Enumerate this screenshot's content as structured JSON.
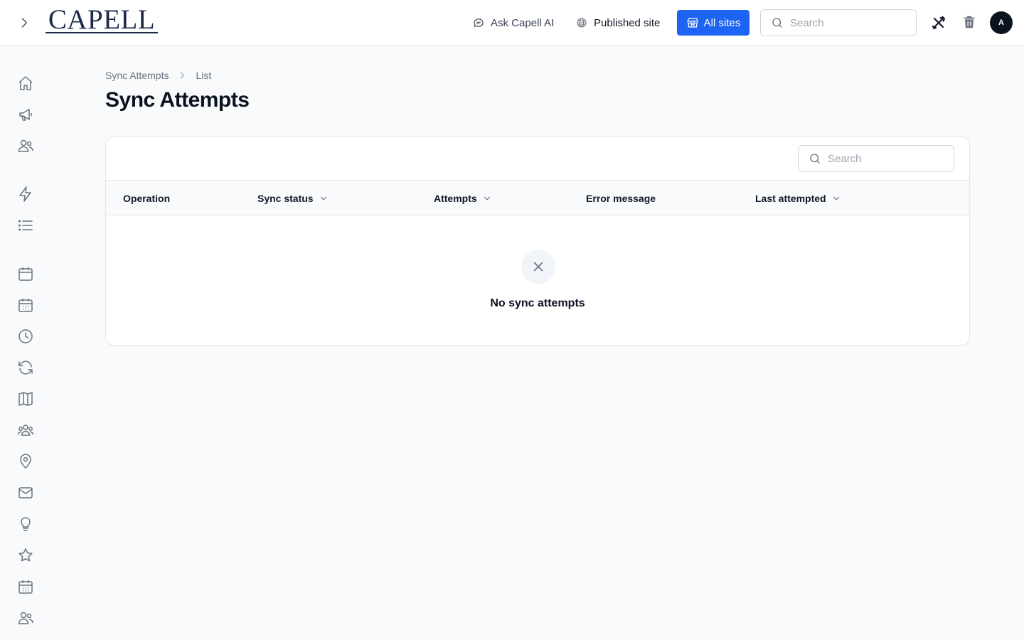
{
  "header": {
    "logo_text": "CAPELL",
    "ask_ai_label": "Ask Capell AI",
    "published_label": "Published site",
    "all_sites_label": "All sites",
    "search_placeholder": "Search",
    "avatar_initial": "A",
    "brand_color": "#1d64f2"
  },
  "sidebar": {
    "icons": [
      "home-icon",
      "megaphone-icon",
      "users-icon",
      "lightning-icon",
      "list-icon",
      "calendar-icon",
      "calendar-grid-icon",
      "clock-icon",
      "refresh-icon",
      "map-icon",
      "user-group-icon",
      "map-pin-icon",
      "envelope-icon",
      "lightbulb-icon",
      "star-icon",
      "calendar-grid-icon",
      "users-icon"
    ]
  },
  "breadcrumb": {
    "items": [
      "Sync Attempts",
      "List"
    ]
  },
  "page": {
    "title": "Sync Attempts"
  },
  "table": {
    "search_placeholder": "Search",
    "columns": [
      {
        "label": "Operation",
        "sortable": false
      },
      {
        "label": "Sync status",
        "sortable": true
      },
      {
        "label": "Attempts",
        "sortable": true
      },
      {
        "label": "Error message",
        "sortable": false
      },
      {
        "label": "Last attempted",
        "sortable": true
      }
    ],
    "rows": [],
    "empty_text": "No sync attempts"
  }
}
